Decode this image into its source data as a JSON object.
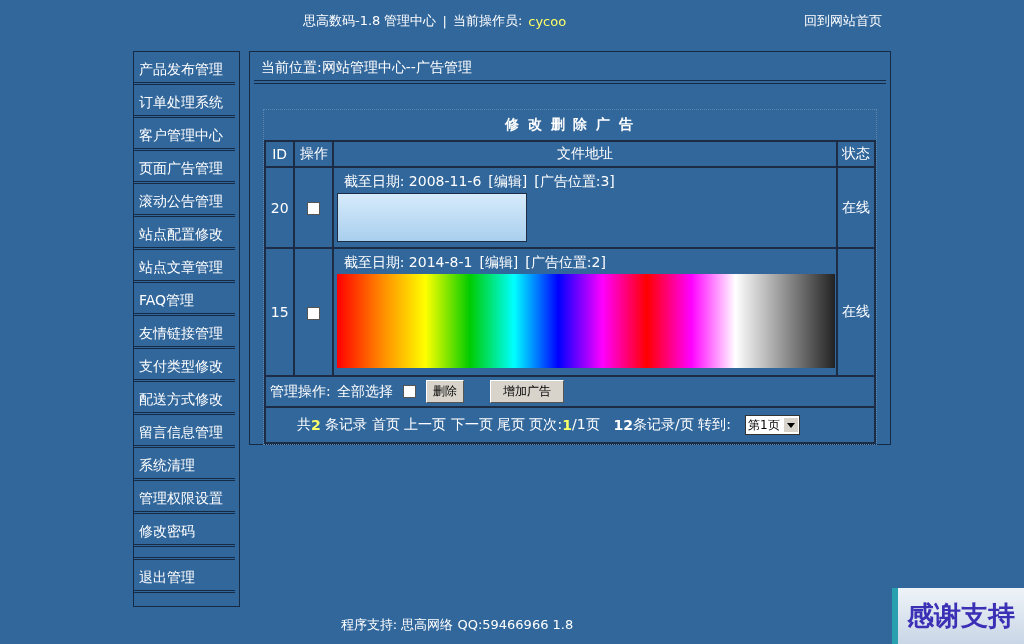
{
  "header": {
    "title": "思高数码-1.8 管理中心",
    "separator": "|",
    "operator_label": "当前操作员:",
    "operator": "cycoo",
    "home_link": "回到网站首页"
  },
  "sidebar": {
    "items": [
      {
        "label": "产品发布管理"
      },
      {
        "label": "订单处理系统"
      },
      {
        "label": "客户管理中心"
      },
      {
        "label": "页面广告管理"
      },
      {
        "label": "滚动公告管理"
      },
      {
        "label": "站点配置修改"
      },
      {
        "label": "站点文章管理"
      },
      {
        "label": "FAQ管理"
      },
      {
        "label": "友情链接管理"
      },
      {
        "label": "支付类型修改"
      },
      {
        "label": "配送方式修改"
      },
      {
        "label": "留言信息管理"
      },
      {
        "label": "系统清理"
      },
      {
        "label": "管理权限设置"
      },
      {
        "label": "修改密码"
      }
    ],
    "exit_item": "退出管理"
  },
  "breadcrumb": "当前位置:网站管理中心--广告管理",
  "table": {
    "title": "修 改 删 除 广 告",
    "columns": [
      "ID",
      "操作",
      "文件地址",
      "状态"
    ],
    "rows": [
      {
        "id": "20",
        "checked": false,
        "expiry_label": "截至日期:",
        "date": "2008-11-6",
        "edit_link": "[编辑]",
        "position": "[广告位置:3]",
        "kind": "small",
        "status": "在线"
      },
      {
        "id": "15",
        "checked": false,
        "expiry_label": "截至日期:",
        "date": "2014-8-1",
        "edit_link": "[编辑]",
        "position": "[广告位置:2]",
        "kind": "wide",
        "status": "在线"
      }
    ]
  },
  "actions": {
    "label": "管理操作:",
    "select_all_label": "全部选择",
    "select_all_checked": false,
    "buttons": [
      "删除",
      "增加广告"
    ]
  },
  "pager": {
    "segments": [
      {
        "kind": "plain",
        "text": "共"
      },
      {
        "kind": "number",
        "text": "2"
      },
      {
        "kind": "plain",
        "text": " 条记录 首页 上一页 下一页 尾页 页次:"
      },
      {
        "kind": "number",
        "text": "1"
      },
      {
        "kind": "plain",
        "text": "/1页"
      },
      {
        "kind": "bold",
        "text": "12"
      },
      {
        "kind": "plain",
        "text": "条记录/页 转到:"
      }
    ],
    "select_value": "第1页"
  },
  "footer": "程序支持: 思高网络 QQ:59466966 1.8",
  "corner_badge": "感谢支持"
}
